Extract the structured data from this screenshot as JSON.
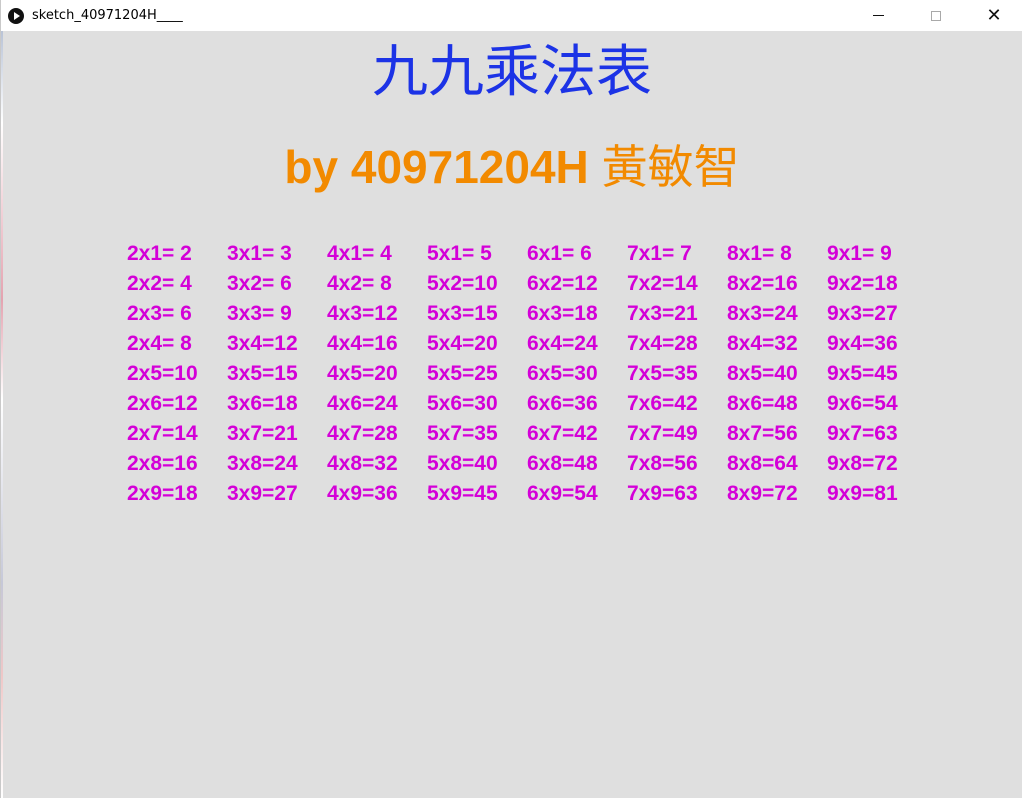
{
  "window": {
    "title": "sketch_40971204H____",
    "app_icon": "processing-play-icon",
    "controls": {
      "minimize_icon": "minimize-icon",
      "maximize_icon": "maximize-icon",
      "close_icon": "close-icon"
    }
  },
  "page": {
    "title": "九九乘法表",
    "subtitle_prefix": "by 40971204H",
    "subtitle_name": "黃敏智"
  },
  "table": {
    "columns": [
      [
        "2x1= 2",
        "2x2= 4",
        "2x3= 6",
        "2x4= 8",
        "2x5=10",
        "2x6=12",
        "2x7=14",
        "2x8=16",
        "2x9=18"
      ],
      [
        "3x1= 3",
        "3x2= 6",
        "3x3= 9",
        "3x4=12",
        "3x5=15",
        "3x6=18",
        "3x7=21",
        "3x8=24",
        "3x9=27"
      ],
      [
        "4x1= 4",
        "4x2= 8",
        "4x3=12",
        "4x4=16",
        "4x5=20",
        "4x6=24",
        "4x7=28",
        "4x8=32",
        "4x9=36"
      ],
      [
        "5x1= 5",
        "5x2=10",
        "5x3=15",
        "5x4=20",
        "5x5=25",
        "5x6=30",
        "5x7=35",
        "5x8=40",
        "5x9=45"
      ],
      [
        "6x1= 6",
        "6x2=12",
        "6x3=18",
        "6x4=24",
        "6x5=30",
        "6x6=36",
        "6x7=42",
        "6x8=48",
        "6x9=54"
      ],
      [
        "7x1= 7",
        "7x2=14",
        "7x3=21",
        "7x4=28",
        "7x5=35",
        "7x6=42",
        "7x7=49",
        "7x8=56",
        "7x9=63"
      ],
      [
        "8x1= 8",
        "8x2=16",
        "8x3=24",
        "8x4=32",
        "8x5=40",
        "8x6=48",
        "8x7=56",
        "8x8=64",
        "8x9=72"
      ],
      [
        "9x1= 9",
        "9x2=18",
        "9x3=27",
        "9x4=36",
        "9x5=45",
        "9x6=54",
        "9x7=63",
        "9x8=72",
        "9x9=81"
      ]
    ]
  },
  "colors": {
    "canvas_background": "#dfdfdf",
    "title": "#1c33e6",
    "subtitle": "#f28a00",
    "table_text": "#d400d8"
  }
}
